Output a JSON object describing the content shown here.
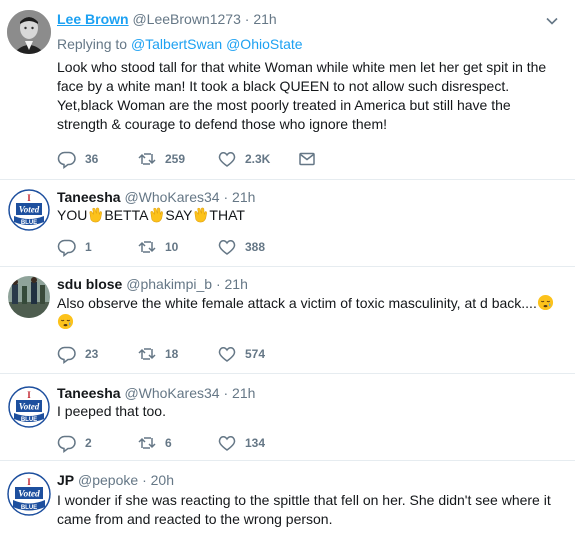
{
  "tweets": [
    {
      "name": "Lee Brown",
      "handle": "@LeeBrown1273",
      "time": "21h",
      "replying_prefix": "Replying to",
      "replying_to": [
        "@TalbertSwan",
        "@OhioState"
      ],
      "lines": [
        "Look who stood tall for that white Woman while white men let her get spit in the",
        "face by a white man! It took a black QUEEN to not allow such disrespect.",
        "Yet,black Woman are the most poorly treated in America but still have the",
        "strength & courage to defend those who ignore them!"
      ],
      "replies": "36",
      "retweets": "259",
      "likes": "2.3K"
    },
    {
      "name": "Taneesha",
      "handle": "@WhoKares34",
      "time": "21h",
      "parts": [
        "YOU",
        "BETTA",
        "SAY",
        "THAT"
      ],
      "replies": "1",
      "retweets": "10",
      "likes": "388"
    },
    {
      "name": "sdu blose",
      "handle": "@phakimpi_b",
      "time": "21h",
      "text": "Also observe the white female attack a victim of toxic masculinity, at d back....",
      "replies": "23",
      "retweets": "18",
      "likes": "574"
    },
    {
      "name": "Taneesha",
      "handle": "@WhoKares34",
      "time": "21h",
      "text": "I peeped that too.",
      "replies": "2",
      "retweets": "6",
      "likes": "134"
    },
    {
      "name": "JP",
      "handle": "@pepoke",
      "time": "20h",
      "lines": [
        "I wonder if she was reacting to the spittle that fell on her.  She didn't see where it",
        "came from and reacted to the wrong person."
      ]
    }
  ],
  "avatar_badge": {
    "top": "I",
    "middle": "Voted",
    "bottom": "BLUE"
  },
  "separator": "·",
  "icons": [
    "reply-icon",
    "retweet-icon",
    "like-icon",
    "direct-message-icon",
    "chevron-down-icon",
    "clapping-hands-emoji",
    "sleepy-face-emoji"
  ],
  "colors": {
    "link": "#1da1f2",
    "muted": "#657786",
    "text": "#14171a",
    "border": "#e6ecf0",
    "badge_blue": "#1d4f9e"
  }
}
